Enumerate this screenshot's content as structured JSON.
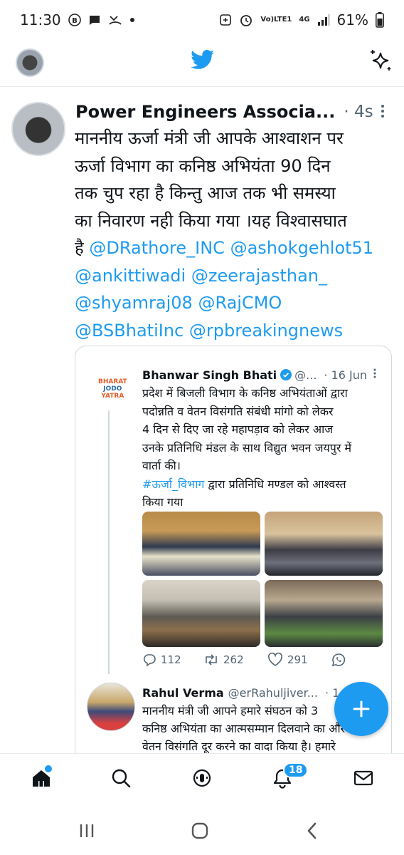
{
  "status_bar": {
    "time": "11:30",
    "network_label_top": "Vo)",
    "network_label_bottom": "LTE1",
    "network_type": "4G",
    "battery": "61%"
  },
  "tweet": {
    "author": "Power Engineers Associa...",
    "time": "4s",
    "text_lines": [
      "माननीय ऊर्जा मंत्री जी आपके आश्वाशन पर",
      "ऊर्जा विभाग का कनिष्ठ अभियंता 90 दिन",
      "तक चुप रहा है किन्तु आज तक भी समस्या",
      "का निवारण नही किया गया ।यह विश्वासघात"
    ],
    "line5_prefix": "है ",
    "mentions": {
      "m1": "@DRathore_INC",
      "m2": "@ashokgehlot51",
      "m3": "@ankittiwadi",
      "m4": "@zeerajasthan_",
      "m5": "@shyamraj08",
      "m6": "@RajCMO",
      "m7": "@BSBhatiInc",
      "m8": "@rpbreakingnews"
    }
  },
  "quote": {
    "logo_line1": "BHARAT",
    "logo_line2": "JODO",
    "logo_line3": "YATRA",
    "author": "Bhanwar Singh Bhati",
    "handle": "@...",
    "time": "· 16 Jun",
    "body_lines": [
      "प्रदेश में बिजली विभाग के कनिष्ठ अभियंताओं द्वारा",
      "पदोन्नति व वेतन विसंगति संबंधी मांगो को लेकर",
      "4 दिन से दिए जा रहे महापड़ाव को लेकर आज",
      "उनके प्रतिनिधि मंडल के साथ विद्युत भवन जयपुर में",
      "वार्ता की।"
    ],
    "hashtag": "#ऊर्जा_विभाग",
    "hashtag_rest": " द्वारा प्रतिनिधि मण्डल को आश्वस्त",
    "last_line": "किया गया",
    "replies": "112",
    "retweets": "262",
    "likes": "291",
    "reply2": {
      "author": "Rahul Verma",
      "handle": "@erRahuljiver...",
      "time": "· 1",
      "line1": "माननीय मंत्री जी आपने हमारे संघठन को 3",
      "line2": "कनिष्ठ अभियंता का आत्मसम्मान दिलवाने का और",
      "line3": "वेतन विसंगति दूर करने का वादा किया है। हमारे"
    }
  },
  "tabbar": {
    "notifications_count": "18"
  },
  "colors": {
    "accent": "#1d9bf0",
    "text": "#0f1419",
    "secondary": "#536471"
  }
}
